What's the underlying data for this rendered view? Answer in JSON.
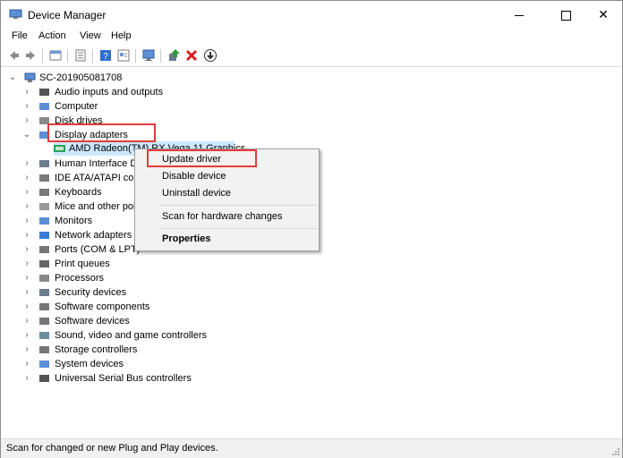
{
  "window": {
    "title": "Device Manager"
  },
  "menu": [
    "File",
    "Action",
    "View",
    "Help"
  ],
  "toolbar": [
    "back-icon",
    "forward-icon",
    "properties-icon",
    "list-icon",
    "help-icon",
    "details-icon",
    "monitor-icon",
    "add-driver-icon",
    "remove-icon",
    "download-icon"
  ],
  "tree": {
    "root": "SC-201905081708",
    "categories": [
      {
        "label": "Audio inputs and outputs",
        "icon": "speaker-icon"
      },
      {
        "label": "Computer",
        "icon": "computer-icon"
      },
      {
        "label": "Disk drives",
        "icon": "disk-icon"
      },
      {
        "label": "Display adapters",
        "icon": "display-icon"
      },
      {
        "label": "Human Interface D",
        "icon": "hid-icon"
      },
      {
        "label": "IDE ATA/ATAPI con",
        "icon": "ide-icon"
      },
      {
        "label": "Keyboards",
        "icon": "keyboard-icon"
      },
      {
        "label": "Mice and other poi",
        "icon": "mouse-icon"
      },
      {
        "label": "Monitors",
        "icon": "monitor-icon"
      },
      {
        "label": "Network adapters",
        "icon": "network-icon"
      },
      {
        "label": "Ports (COM & LPT)",
        "icon": "port-icon"
      },
      {
        "label": "Print queues",
        "icon": "printer-icon"
      },
      {
        "label": "Processors",
        "icon": "processor-icon"
      },
      {
        "label": "Security devices",
        "icon": "security-icon"
      },
      {
        "label": "Software components",
        "icon": "software-components-icon"
      },
      {
        "label": "Software devices",
        "icon": "software-devices-icon"
      },
      {
        "label": "Sound, video and game controllers",
        "icon": "sound-icon"
      },
      {
        "label": "Storage controllers",
        "icon": "storage-icon"
      },
      {
        "label": "System devices",
        "icon": "system-icon"
      },
      {
        "label": "Universal Serial Bus controllers",
        "icon": "usb-icon"
      }
    ],
    "child": "AMD Radeon(TM) RX Vega 11 Graphics"
  },
  "context_menu": {
    "update": "Update driver",
    "disable": "Disable device",
    "uninstall": "Uninstall device",
    "scan": "Scan for hardware changes",
    "properties": "Properties"
  },
  "status": "Scan for changed or new Plug and Play devices."
}
